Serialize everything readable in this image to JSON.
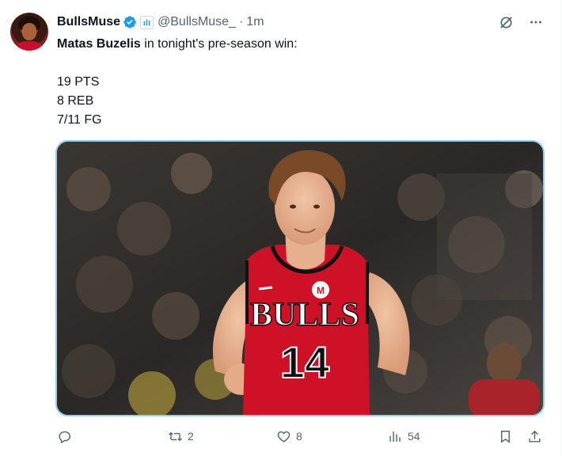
{
  "tweet": {
    "author_name": "BullsMuse",
    "handle": "@BullsMuse_",
    "separator": "·",
    "time": "1m",
    "text_bold": "Matas Buzelis",
    "text_rest": " in tonight's pre-season win:",
    "stats": [
      "19 PTS",
      "8 REB",
      "7/11 FG"
    ],
    "media": {
      "jersey_team": "BULLS",
      "jersey_number": "14",
      "accent_color": "#1d9bf0",
      "jersey_color": "#ce1126"
    },
    "actions": {
      "reply_count": "",
      "retweet_count": "2",
      "like_count": "8",
      "views_count": "54"
    },
    "icons": {
      "verified": "verified-badge-icon",
      "affiliate": "affiliate-badge-icon",
      "grok": "grok-icon",
      "more": "more-icon",
      "reply": "reply-icon",
      "retweet": "retweet-icon",
      "like": "like-icon",
      "views": "views-icon",
      "bookmark": "bookmark-icon",
      "share": "share-icon"
    }
  }
}
